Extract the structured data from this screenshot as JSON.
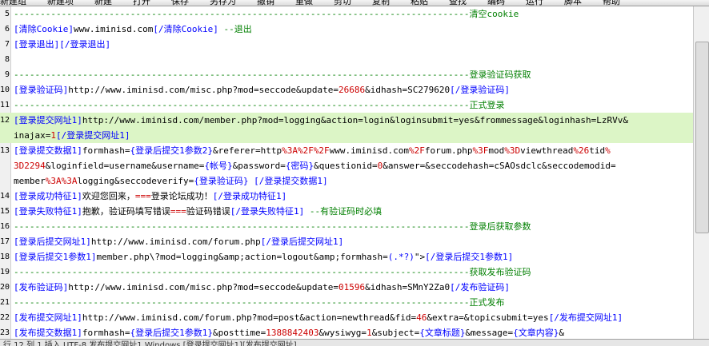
{
  "toolbar": {
    "items": [
      "新建组",
      "新建项",
      "新建",
      "打开",
      "保存",
      "另存为",
      "撤销",
      "重做",
      "剪切",
      "复制",
      "粘贴",
      "查找",
      "编码",
      "运行",
      "脚本",
      "帮助"
    ]
  },
  "editor": {
    "lines": [
      {
        "n": "5",
        "hl": false,
        "segs": [
          {
            "t": "--------------------------------------------------------------------------------------",
            "c": "g"
          },
          {
            "t": "清空cookie",
            "c": "g"
          }
        ]
      },
      {
        "n": "6",
        "hl": false,
        "segs": [
          {
            "t": "[清除Cookie]",
            "c": "t"
          },
          {
            "t": "www.iminisd.com",
            "c": ""
          },
          {
            "t": "[/清除Cookie]",
            "c": "t"
          },
          {
            "t": " --退出",
            "c": "g"
          }
        ]
      },
      {
        "n": "7",
        "hl": false,
        "segs": [
          {
            "t": "[登录退出][/登录退出]",
            "c": "t"
          }
        ]
      },
      {
        "n": "8",
        "hl": false,
        "segs": [
          {
            "t": "",
            "c": ""
          }
        ]
      },
      {
        "n": "9",
        "hl": false,
        "segs": [
          {
            "t": "--------------------------------------------------------------------------------------",
            "c": "g"
          },
          {
            "t": "登录验证码获取",
            "c": "g"
          }
        ]
      },
      {
        "n": "10",
        "hl": false,
        "segs": [
          {
            "t": "[登录验证码]",
            "c": "t"
          },
          {
            "t": "http://www.iminisd.com/misc.php?mod=seccode&update=",
            "c": ""
          },
          {
            "t": "26686",
            "c": "r"
          },
          {
            "t": "&idhash=SC279620",
            "c": ""
          },
          {
            "t": "[/登录验证码]",
            "c": "t"
          }
        ]
      },
      {
        "n": "11",
        "hl": false,
        "segs": [
          {
            "t": "--------------------------------------------------------------------------------------",
            "c": "g"
          },
          {
            "t": "正式登录",
            "c": "g"
          }
        ]
      },
      {
        "n": "12",
        "hl": true,
        "segs": [
          {
            "t": "[登录提交网址1]",
            "c": "t"
          },
          {
            "t": "http://www.iminisd.com/member.php?mod=logging&action=login&loginsubmit=yes&frommessage&loginhash=LzRVv&",
            "c": ""
          }
        ]
      },
      {
        "n": "",
        "hl": true,
        "segs": [
          {
            "t": "inajax=",
            "c": ""
          },
          {
            "t": "1",
            "c": "r"
          },
          {
            "t": "[/登录提交网址1]",
            "c": "t"
          }
        ]
      },
      {
        "n": "13",
        "hl": false,
        "segs": [
          {
            "t": "[登录提交数据1]",
            "c": "t"
          },
          {
            "t": "formhash=",
            "c": ""
          },
          {
            "t": "{登录后提交1参数2}",
            "c": "b"
          },
          {
            "t": "&referer=http",
            "c": ""
          },
          {
            "t": "%3A%2F%2F",
            "c": "r"
          },
          {
            "t": "www.iminisd.com",
            "c": ""
          },
          {
            "t": "%2F",
            "c": "r"
          },
          {
            "t": "forum.php",
            "c": ""
          },
          {
            "t": "%3F",
            "c": "r"
          },
          {
            "t": "mod",
            "c": ""
          },
          {
            "t": "%3D",
            "c": "r"
          },
          {
            "t": "viewthread",
            "c": ""
          },
          {
            "t": "%26",
            "c": "r"
          },
          {
            "t": "tid",
            "c": ""
          },
          {
            "t": "%",
            "c": "r"
          }
        ]
      },
      {
        "n": "",
        "hl": false,
        "segs": [
          {
            "t": "3D2294",
            "c": "r"
          },
          {
            "t": "&loginfield=username&username=",
            "c": ""
          },
          {
            "t": "{帐号}",
            "c": "b"
          },
          {
            "t": "&password=",
            "c": ""
          },
          {
            "t": "{密码}",
            "c": "b"
          },
          {
            "t": "&questionid=",
            "c": ""
          },
          {
            "t": "0",
            "c": "r"
          },
          {
            "t": "&answer=&seccodehash=cSAOsdclc&seccodemodid=",
            "c": ""
          }
        ]
      },
      {
        "n": "",
        "hl": false,
        "segs": [
          {
            "t": "member",
            "c": ""
          },
          {
            "t": "%3A%3A",
            "c": "r"
          },
          {
            "t": "logging&seccodeverify=",
            "c": ""
          },
          {
            "t": "{登录验证码}",
            "c": "b"
          },
          {
            "t": " [/登录提交数据1]",
            "c": "t"
          }
        ]
      },
      {
        "n": "14",
        "hl": false,
        "segs": [
          {
            "t": "[登录成功特征1]",
            "c": "t"
          },
          {
            "t": "欢迎您回来，",
            "c": ""
          },
          {
            "t": "===",
            "c": "r"
          },
          {
            "t": "登录论坛成功！",
            "c": ""
          },
          {
            "t": "[/登录成功特征1]",
            "c": "t"
          }
        ]
      },
      {
        "n": "15",
        "hl": false,
        "segs": [
          {
            "t": "[登录失败特征1]",
            "c": "t"
          },
          {
            "t": "抱歉，验证码填写错误",
            "c": ""
          },
          {
            "t": "===",
            "c": "r"
          },
          {
            "t": "验证码错误",
            "c": ""
          },
          {
            "t": "[/登录失败特征1]",
            "c": "t"
          },
          {
            "t": " --有验证码时必填",
            "c": "g"
          }
        ]
      },
      {
        "n": "16",
        "hl": false,
        "segs": [
          {
            "t": "--------------------------------------------------------------------------------------",
            "c": "g"
          },
          {
            "t": "登录后获取参数",
            "c": "g"
          }
        ]
      },
      {
        "n": "17",
        "hl": false,
        "segs": [
          {
            "t": "[登录后提交网址1]",
            "c": "t"
          },
          {
            "t": "http://www.iminisd.com/forum.php",
            "c": ""
          },
          {
            "t": "[/登录后提交网址1]",
            "c": "t"
          }
        ]
      },
      {
        "n": "18",
        "hl": false,
        "segs": [
          {
            "t": "[登录后提交1参数1]",
            "c": "t"
          },
          {
            "t": "member.php\\?mod=logging&amp;action=logout&amp;formhash=",
            "c": ""
          },
          {
            "t": "(.*?)",
            "c": "b"
          },
          {
            "t": "\">",
            "c": ""
          },
          {
            "t": "[/登录后提交1参数1]",
            "c": "t"
          }
        ]
      },
      {
        "n": "19",
        "hl": false,
        "segs": [
          {
            "t": "--------------------------------------------------------------------------------------",
            "c": "g"
          },
          {
            "t": "获取发布验证码",
            "c": "g"
          }
        ]
      },
      {
        "n": "20",
        "hl": false,
        "segs": [
          {
            "t": "[发布验证码]",
            "c": "t"
          },
          {
            "t": "http://www.iminisd.com/misc.php?mod=seccode&update=",
            "c": ""
          },
          {
            "t": "01596",
            "c": "r"
          },
          {
            "t": "&idhash=SMnY2Za0",
            "c": ""
          },
          {
            "t": "[/发布验证码]",
            "c": "t"
          }
        ]
      },
      {
        "n": "21",
        "hl": false,
        "segs": [
          {
            "t": "--------------------------------------------------------------------------------------",
            "c": "g"
          },
          {
            "t": "正式发布",
            "c": "g"
          }
        ]
      },
      {
        "n": "22",
        "hl": false,
        "segs": [
          {
            "t": "[发布提交网址1]",
            "c": "t"
          },
          {
            "t": "http://www.iminisd.com/forum.php?mod=post&action=newthread&fid=",
            "c": ""
          },
          {
            "t": "46",
            "c": "r"
          },
          {
            "t": "&extra=&topicsubmit=yes",
            "c": ""
          },
          {
            "t": "[/发布提交网址1]",
            "c": "t"
          }
        ]
      },
      {
        "n": "23",
        "hl": false,
        "segs": [
          {
            "t": "[发布提交数据1]",
            "c": "t"
          },
          {
            "t": "formhash=",
            "c": ""
          },
          {
            "t": "{登录后提交1参数1}",
            "c": "b"
          },
          {
            "t": "&posttime=",
            "c": ""
          },
          {
            "t": "1388842403",
            "c": "r"
          },
          {
            "t": "&wysiwyg=",
            "c": ""
          },
          {
            "t": "1",
            "c": "r"
          },
          {
            "t": "&subject=",
            "c": ""
          },
          {
            "t": "{文章标题}",
            "c": "b"
          },
          {
            "t": "&message=",
            "c": ""
          },
          {
            "t": "{文章内容}",
            "c": "b"
          },
          {
            "t": "&",
            "c": ""
          }
        ]
      }
    ]
  },
  "statusbar": {
    "text": "行 12   列 1   插入   UTF-8   发布提交网址1   Windows   [登录提交网址1][发布提交网址]"
  },
  "colors": {
    "tag": "#0000ff",
    "number": "#cc0000",
    "comment": "#007f00",
    "highlight": "#dcf5c6"
  }
}
